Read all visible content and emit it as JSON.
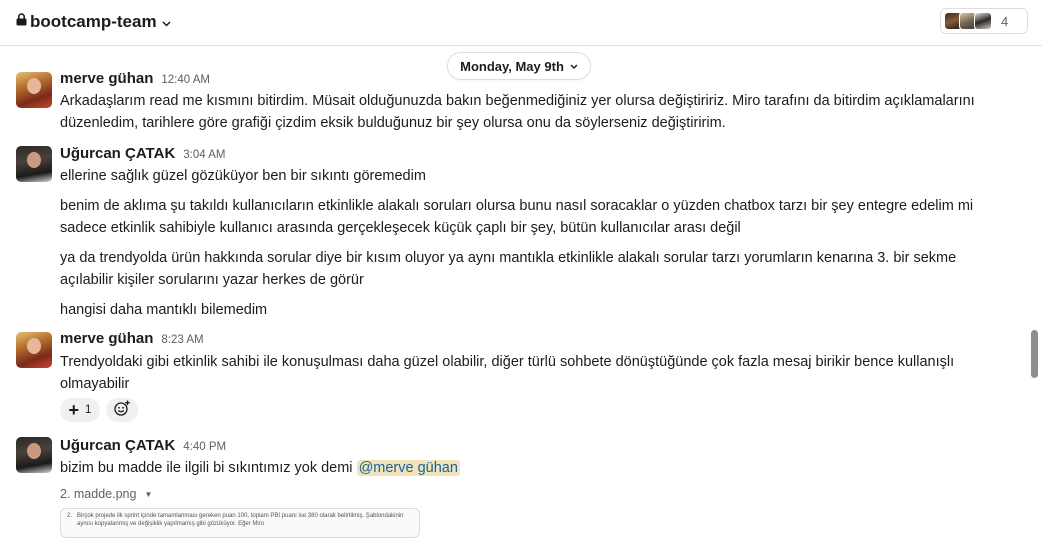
{
  "header": {
    "channel_name": "bootcamp-team",
    "member_count": "4"
  },
  "date_divider": "Monday, May 9th",
  "messages": [
    {
      "author": "merve gühan",
      "time": "12:40 AM",
      "avatar_icon": "user-avatar-merve",
      "paragraphs": [
        "Arkadaşlarım read me kısmını bitirdim. Müsait olduğunuzda bakın beğenmediğiniz yer olursa değiştiririz. Miro tarafını da bitirdim açıklamalarını düzenledim, tarihlere göre grafiği çizdim eksik bulduğunuz bir şey olursa onu da söylerseniz değiştiririm."
      ]
    },
    {
      "author": "Uğurcan ÇATAK",
      "time": "3:04 AM",
      "avatar_icon": "user-avatar-ugurcan",
      "paragraphs": [
        "ellerine sağlık güzel gözüküyor ben bir sıkıntı göremedim",
        "benim de aklıma şu takıldı kullanıcıların etkinlikle alakalı soruları olursa bunu nasıl soracaklar o yüzden chatbox tarzı bir şey entegre edelim mi sadece etkinlik sahibiyle kullanıcı arasında gerçekleşecek küçük çaplı bir şey, bütün kullanıcılar arası değil",
        "ya da trendyolda ürün hakkında sorular diye bir kısım oluyor ya aynı mantıkla etkinlikle alakalı sorular tarzı yorumların kenarına 3. bir sekme açılabilir kişiler sorularını yazar herkes de görür",
        "hangisi daha mantıklı bilemedim"
      ]
    },
    {
      "author": "merve gühan",
      "time": "8:23 AM",
      "avatar_icon": "user-avatar-merve",
      "paragraphs": [
        "Trendyoldaki gibi etkinlik sahibi ile konuşulması daha güzel olabilir, diğer türlü sohbete dönüştüğünde çok fazla mesaj birikir bence kullanışlı olmayabilir"
      ],
      "reaction": {
        "icon": "plus-one-icon",
        "count": "1"
      }
    },
    {
      "author": "Uğurcan ÇATAK",
      "time": "4:40 PM",
      "avatar_icon": "user-avatar-ugurcan",
      "text": "bizim bu madde ile ilgili bi sıkıntımız yok demi",
      "mention": "@merve gühan",
      "file": {
        "name": "2. madde.png",
        "preview_number": "2.",
        "preview_text": "Birçok projede ilk sprint içinde tamamlanması gereken puan 100, toplam PBI puanı ise 380 olarak belirtilmiş. Şablondakinin aynısı kopyalanmış ve değişiklik yapılmamış gibi gözüküyor. Eğer Miro"
      }
    }
  ],
  "colors": {
    "mention_bg": "#f2e4b8",
    "mention_text": "#1264a3",
    "scrollbar": "#8e8e8e"
  }
}
